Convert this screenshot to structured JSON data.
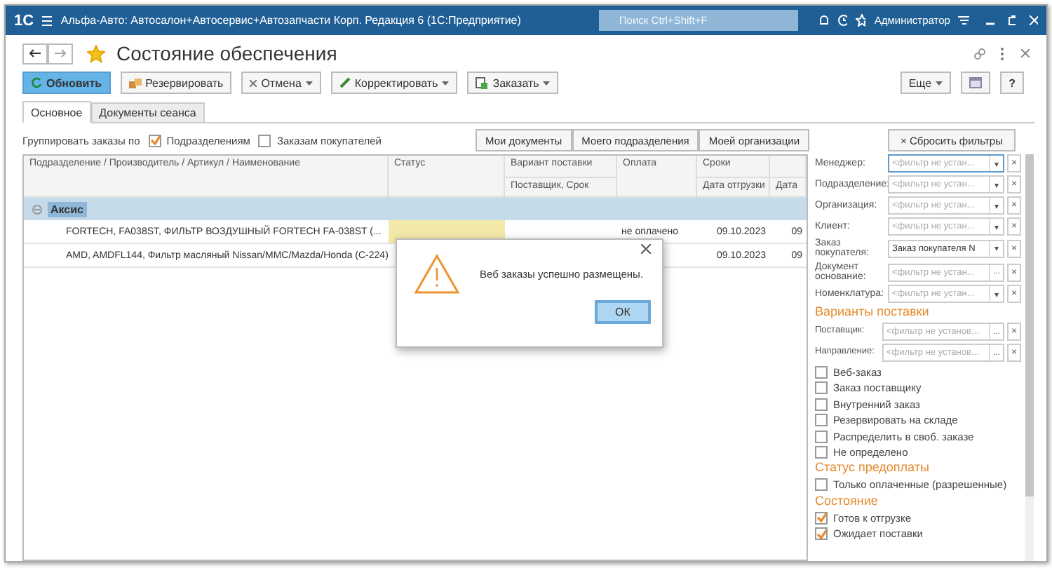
{
  "app": {
    "logo": "1С",
    "title": "Альфа-Авто: Автосалон+Автосервис+Автозапчасти Корп. Редакция 6  (1С:Предприятие)",
    "search_placeholder": "Поиск Ctrl+Shift+F",
    "user": "Администратор"
  },
  "form": {
    "title": "Состояние обеспечения",
    "favorite": true
  },
  "toolbar": [
    {
      "label": "Обновить",
      "kind": "primary",
      "dropdown": false
    },
    {
      "label": "Резервировать",
      "kind": "normal",
      "dropdown": false
    },
    {
      "label": "Отмена",
      "kind": "normal",
      "dropdown": true
    },
    {
      "label": "Корректировать",
      "kind": "normal",
      "dropdown": true
    },
    {
      "label": "Заказать",
      "kind": "normal",
      "dropdown": true
    }
  ],
  "toolbar_right": {
    "more": "Еще",
    "help": "?"
  },
  "tabs": [
    {
      "label": "Основное",
      "selected": true
    },
    {
      "label": "Документы сеанса",
      "selected": false
    }
  ],
  "group_by": {
    "label": "Группировать заказы по",
    "options": [
      {
        "label": "Подразделениям",
        "checked": true
      },
      {
        "label": "Заказам покупателей",
        "checked": false
      }
    ]
  },
  "scope_buttons": [
    "Мои документы",
    "Моего подразделения",
    "Моей организации"
  ],
  "reset_filters": {
    "icon": "×",
    "label": "Сбросить фильтры"
  },
  "table": {
    "columns": [
      {
        "top": "Подразделение / Производитель / Артикул / Наименование"
      },
      {
        "top": "Статус"
      },
      {
        "top": "Вариант поставки",
        "bottom": "Поставщик, Срок"
      },
      {
        "top": "Оплата"
      },
      {
        "top": "Сроки",
        "bottom": "Дата отгрузки"
      },
      {
        "bottom": "Дата"
      }
    ],
    "group": {
      "label": "Аксис",
      "expanded": true
    },
    "rows": [
      {
        "name": "FORTECH, FA038ST, ФИЛЬТР ВОЗДУШНЫЙ FORTECH FA-038ST (...",
        "status_highlight": true,
        "payment": "не оплачено",
        "ship_date": "09.10.2023",
        "date2": "09"
      },
      {
        "name": "AMD, AMDFL144, Фильтр масляный Nissan/MMC/Mazda/Honda (C-224)",
        "status_highlight": false,
        "ship_date": "09.10.2023",
        "date2": "09"
      }
    ]
  },
  "filters": [
    {
      "label": "Менеджер:",
      "placeholder": "<фильтр не устан...",
      "button": "▾",
      "focused": true
    },
    {
      "label": "Подразделение:",
      "placeholder": "<фильтр не устан...",
      "button": "▾",
      "focused": false
    },
    {
      "label": "Организация:",
      "placeholder": "<фильтр не устан...",
      "button": "▾",
      "focused": false
    },
    {
      "label": "Клиент:",
      "placeholder": "<фильтр не устан...",
      "button": "▾",
      "focused": false
    },
    {
      "label": "Заказ покупателя:",
      "value": "Заказ покупателя N",
      "button": "▾",
      "focused": false
    },
    {
      "label": "Документ основание:",
      "placeholder": "<фильтр не устан...",
      "button": "...",
      "focused": false
    },
    {
      "label": "Номенклатура:",
      "placeholder": "<фильтр не устан...",
      "button": "▾",
      "focused": false
    }
  ],
  "delivery": {
    "title": "Варианты поставки",
    "filters": [
      {
        "label": "Поставщик:",
        "placeholder": "<фильтр не установ...",
        "button": "..."
      },
      {
        "label": "Направление:",
        "placeholder": "<фильтр не установ...",
        "button": "..."
      }
    ],
    "checks": [
      {
        "label": "Веб-заказ",
        "checked": false
      },
      {
        "label": "Заказ поставщику",
        "checked": false
      },
      {
        "label": "Внутренний заказ",
        "checked": false
      },
      {
        "label": "Резервировать на складе",
        "checked": false
      },
      {
        "label": "Распределить в своб. заказе",
        "checked": false
      },
      {
        "label": "Не определено",
        "checked": false
      }
    ]
  },
  "prepay": {
    "title": "Статус предоплаты",
    "checks": [
      {
        "label": "Только оплаченные (разрешенные)",
        "checked": false
      }
    ]
  },
  "state": {
    "title": "Состояние",
    "checks": [
      {
        "label": "Готов к отгрузке",
        "checked": true
      },
      {
        "label": "Ожидает поставки",
        "checked": true
      }
    ]
  },
  "dialog": {
    "message": "Веб заказы успешно размещены.",
    "ok": "ОК"
  }
}
